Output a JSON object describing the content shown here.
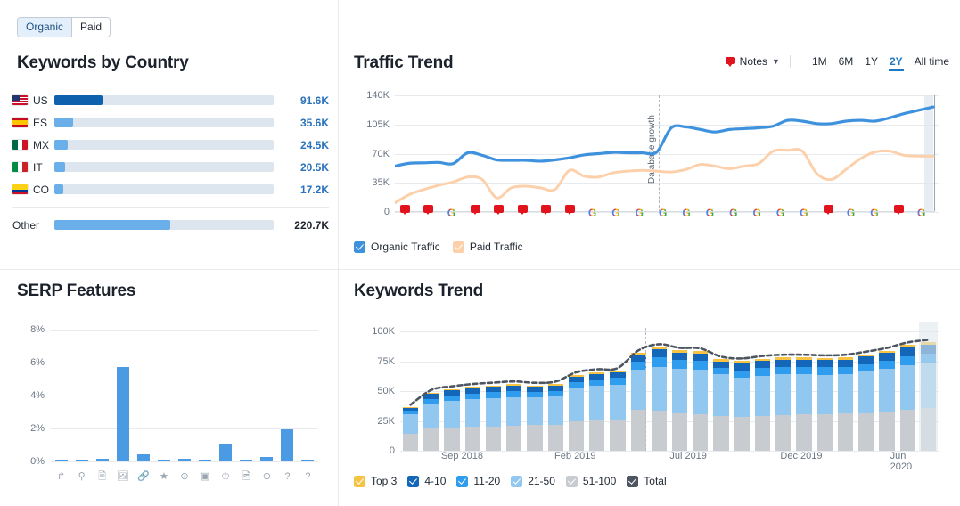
{
  "toggle": {
    "options": [
      {
        "label": "Organic",
        "active": true
      },
      {
        "label": "Paid",
        "active": false
      }
    ]
  },
  "keywords_by_country": {
    "title": "Keywords by Country",
    "rows": [
      {
        "code": "US",
        "flag": "flag-us",
        "value": "91.6K",
        "pct": 22.0,
        "primary": true
      },
      {
        "code": "ES",
        "flag": "flag-es",
        "value": "35.6K",
        "pct": 8.5,
        "primary": false
      },
      {
        "code": "MX",
        "flag": "flag-mx",
        "value": "24.5K",
        "pct": 5.9,
        "primary": false
      },
      {
        "code": "IT",
        "flag": "flag-it",
        "value": "20.5K",
        "pct": 4.9,
        "primary": false
      },
      {
        "code": "CO",
        "flag": "flag-co",
        "value": "17.2K",
        "pct": 4.1,
        "primary": false
      }
    ],
    "other": {
      "label": "Other",
      "value": "220.7K",
      "pct": 53.0
    }
  },
  "serp_features": {
    "title": "SERP Features"
  },
  "traffic_trend": {
    "title": "Traffic Trend",
    "notes_label": "Notes",
    "periods": [
      {
        "label": "1M",
        "active": false
      },
      {
        "label": "6M",
        "active": false
      },
      {
        "label": "1Y",
        "active": false
      },
      {
        "label": "2Y",
        "active": true
      },
      {
        "label": "All time",
        "active": false
      }
    ],
    "annotation": "Database growth",
    "legend": [
      {
        "label": "Organic Traffic",
        "color": "#4a9ae4",
        "checked": true
      },
      {
        "label": "Paid Traffic",
        "color": "#f2862f",
        "checked": true
      }
    ]
  },
  "keywords_trend": {
    "title": "Keywords Trend",
    "legend": [
      {
        "label": "Top 3",
        "color": "#f6c344",
        "checked": true
      },
      {
        "label": "4-10",
        "color": "#1466b8",
        "checked": true
      },
      {
        "label": "11-20",
        "color": "#2f9ced",
        "checked": true
      },
      {
        "label": "21-50",
        "color": "#92c8f0",
        "checked": true
      },
      {
        "label": "51-100",
        "color": "#c8ccd1",
        "checked": true
      },
      {
        "label": "Total",
        "color": "#4d5560",
        "checked": true
      }
    ]
  },
  "chart_data": [
    {
      "type": "bar",
      "name": "Keywords by Country",
      "title": "Keywords by Country",
      "orientation": "horizontal",
      "categories": [
        "US",
        "ES",
        "MX",
        "IT",
        "CO",
        "Other"
      ],
      "values": [
        91600,
        35600,
        24500,
        20500,
        17200,
        220700
      ],
      "value_labels": [
        "91.6K",
        "35.6K",
        "24.5K",
        "20.5K",
        "17.2K",
        "220.7K"
      ],
      "colors": [
        "#0e62ad",
        "#6aaeea",
        "#6aaeea",
        "#6aaeea",
        "#6aaeea",
        "#6aaeea"
      ],
      "track_color": "#dde6ee",
      "xlabel": "",
      "ylabel": "",
      "grid": false,
      "legend": "none"
    },
    {
      "type": "bar",
      "name": "SERP Features",
      "title": "SERP Features",
      "ylabel": "",
      "xlabel": "",
      "ylim": [
        0,
        8
      ],
      "yticks": [
        "0%",
        "2%",
        "4%",
        "6%",
        "8%"
      ],
      "grid": true,
      "legend": "none",
      "bar_color": "#4a9ae4",
      "categories": [
        "sitelinks-icon",
        "local-pack-icon",
        "reviews-icon",
        "image-pack-icon",
        "related-links-icon",
        "featured-snippet-icon",
        "video-icon",
        "video-carousel-icon",
        "top-stories-icon",
        "images-icon",
        "video-player-icon",
        "faq-icon",
        "knowledge-panel-icon"
      ],
      "values": [
        0.08,
        0.07,
        0.14,
        5.75,
        0.45,
        0.08,
        0.18,
        0.07,
        1.1,
        0.07,
        0.25,
        1.95,
        0.06
      ]
    },
    {
      "type": "line",
      "name": "Traffic Trend",
      "title": "Traffic Trend",
      "ylim": [
        0,
        140000
      ],
      "yticks": [
        "0",
        "35K",
        "70K",
        "105K",
        "140K"
      ],
      "grid": true,
      "legend": "bottom",
      "annotations": [
        {
          "text": "Database growth",
          "x_pct": 48.5
        }
      ],
      "series": [
        {
          "name": "Organic Traffic",
          "color": "#3e92dd",
          "values": [
            55000,
            58500,
            59000,
            59500,
            58000,
            71000,
            68000,
            62500,
            62000,
            62000,
            61000,
            62500,
            65000,
            68500,
            70000,
            71500,
            71000,
            71000,
            72000,
            101000,
            102000,
            99000,
            96000,
            99000,
            100000,
            101000,
            103000,
            110000,
            109000,
            106000,
            106000,
            109000,
            110000,
            109000,
            113000,
            118000,
            122000,
            126000
          ]
        },
        {
          "name": "Paid Traffic",
          "color": "#fbd0aa",
          "values": [
            11000,
            21000,
            27000,
            32000,
            36000,
            42000,
            39000,
            17000,
            29000,
            31000,
            29000,
            27000,
            50000,
            43000,
            42000,
            47000,
            49000,
            50000,
            49000,
            48000,
            51000,
            57000,
            55000,
            52000,
            55000,
            58000,
            73000,
            74000,
            73000,
            46000,
            39000,
            51000,
            64000,
            72000,
            73000,
            68000,
            67000,
            67000
          ]
        }
      ],
      "x_markers": [
        "note",
        "note",
        "google",
        "note",
        "note",
        "note",
        "note",
        "note",
        "google",
        "google",
        "google",
        "google",
        "google",
        "google",
        "google",
        "google",
        "google",
        "google",
        "note",
        "google",
        "google",
        "note",
        "google"
      ]
    },
    {
      "type": "bar",
      "name": "Keywords Trend",
      "title": "Keywords Trend",
      "stacked": true,
      "ylim": [
        0,
        100000
      ],
      "yticks": [
        "0",
        "25K",
        "50K",
        "75K",
        "100K"
      ],
      "grid": true,
      "legend": "bottom",
      "xtick_labels": [
        "Sep 2018",
        "Feb 2019",
        "Jul 2019",
        "Dec 2019",
        "Jun 2020"
      ],
      "xtick_positions_pct": [
        11.5,
        32.5,
        53.5,
        74.5,
        94.0
      ],
      "series": [
        {
          "name": "51-100",
          "color": "#c8ccd1",
          "values": [
            14500,
            19000,
            19500,
            20000,
            20500,
            21000,
            21500,
            22000,
            24500,
            25500,
            26500,
            34000,
            33500,
            31500,
            30500,
            29000,
            28500,
            29000,
            30000,
            30500,
            30500,
            31000,
            31500,
            32000,
            34000,
            36000
          ]
        },
        {
          "name": "21-50",
          "color": "#92c8f0",
          "values": [
            16000,
            20000,
            22000,
            23000,
            23500,
            24000,
            23500,
            24000,
            28000,
            29000,
            29000,
            34000,
            37000,
            37000,
            37500,
            35000,
            33000,
            34000,
            34000,
            33500,
            33000,
            33000,
            35000,
            37000,
            38000,
            37000
          ]
        },
        {
          "name": "11-20",
          "color": "#2f9ced",
          "values": [
            3000,
            4500,
            5000,
            5000,
            5000,
            5000,
            4500,
            4000,
            5000,
            5500,
            5500,
            7000,
            8000,
            8000,
            7500,
            5500,
            6000,
            6500,
            6500,
            6500,
            6500,
            6500,
            6000,
            6500,
            7500,
            8000
          ]
        },
        {
          "name": "4-10",
          "color": "#1466b8",
          "values": [
            2000,
            4000,
            4000,
            4500,
            4500,
            4500,
            4000,
            4500,
            4500,
            4500,
            4500,
            5000,
            6500,
            5500,
            6000,
            5500,
            6000,
            6000,
            6000,
            6000,
            6000,
            6000,
            6500,
            6500,
            7000,
            7500
          ]
        },
        {
          "name": "Top 3",
          "color": "#f6c344",
          "values": [
            800,
            1200,
            1200,
            1200,
            1300,
            1300,
            1200,
            1200,
            1500,
            1500,
            1500,
            1800,
            2000,
            2000,
            2000,
            1600,
            1600,
            1700,
            1700,
            1700,
            1700,
            1700,
            1800,
            1900,
            2000,
            2200
          ]
        }
      ],
      "total_line": {
        "name": "Total",
        "color": "#4d5560",
        "style": "dashed"
      }
    }
  ]
}
